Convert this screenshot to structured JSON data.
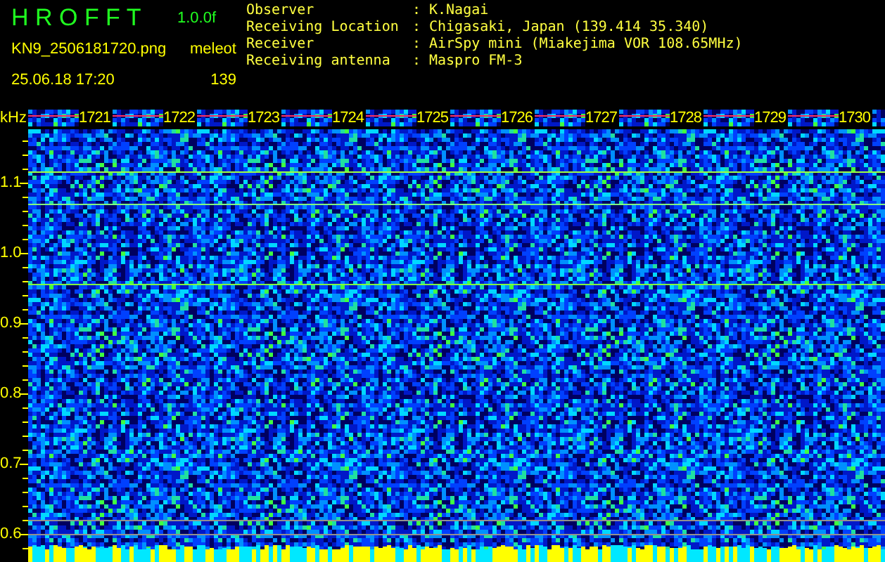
{
  "header": {
    "title": "H R O F F T",
    "version": "1.0.0f",
    "filename": "KN9_2506181720.png",
    "mode": "meleot",
    "datetime": "25.06.18 17:20",
    "count": "139"
  },
  "info": [
    {
      "label": "Observer",
      "separator": ":",
      "value": "K.Nagai"
    },
    {
      "label": "Receiving Location",
      "separator": ":",
      "value": "Chigasaki, Japan (139.414 35.340)"
    },
    {
      "label": "Receiver",
      "separator": ":",
      "value": "AirSpy mini (Miakejima VOR 108.65MHz)"
    },
    {
      "label": "Receiving antenna",
      "separator": ":",
      "value": "Maspro FM-3"
    }
  ],
  "axis": {
    "unit": "kHz",
    "times": [
      "1721",
      "1722",
      "1723",
      "1724",
      "1725",
      "1726",
      "1727",
      "1728",
      "1729",
      "1730"
    ],
    "freq_ticks": [
      "1.1",
      "1.0",
      "0.9",
      "0.8",
      "0.7",
      "0.6"
    ]
  }
}
